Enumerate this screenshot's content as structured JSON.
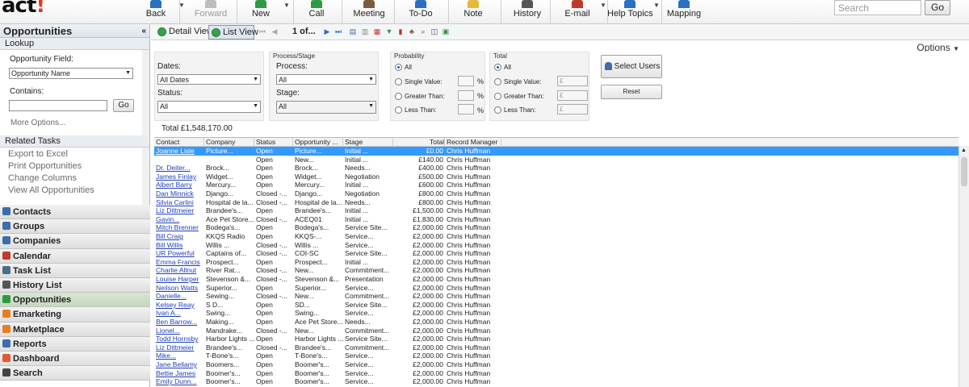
{
  "app": {
    "logo_text": "act",
    "logo_bang": "!"
  },
  "toolbar": [
    {
      "label": "Back",
      "icon": "back-arrow-icon",
      "color": "#2a6fc1",
      "x": 0
    },
    {
      "label": "Forward",
      "icon": "forward-arrow-icon",
      "color": "#bdbdbd",
      "x": 0
    },
    {
      "label": "New",
      "icon": "new-record-icon",
      "color": "#2f9a43",
      "x": 0
    },
    {
      "label": "Call",
      "icon": "phone-icon",
      "color": "#2f9a43",
      "x": 0
    },
    {
      "label": "Meeting",
      "icon": "meeting-icon",
      "color": "#7a5c3c",
      "x": 0
    },
    {
      "label": "To-Do",
      "icon": "todo-icon",
      "color": "#2a6fc1",
      "x": 0
    },
    {
      "label": "Note",
      "icon": "note-icon",
      "color": "#e7b93a",
      "x": 0
    },
    {
      "label": "History",
      "icon": "history-icon",
      "color": "#555555",
      "x": 0
    },
    {
      "label": "E-mail",
      "icon": "email-icon",
      "color": "#c0392b",
      "x": 0
    },
    {
      "label": "Help Topics",
      "icon": "help-icon",
      "color": "#2a6fc1",
      "x": 0
    },
    {
      "label": "Mapping",
      "icon": "globe-icon",
      "color": "#2a6fc1",
      "x": 0
    }
  ],
  "search": {
    "placeholder": "Search",
    "go_label": "Go"
  },
  "left_panel": {
    "title": "Opportunities",
    "collapse_glyph": "«",
    "lookup": {
      "header": "Lookup",
      "field_label": "Opportunity Field:",
      "field_value": "Opportunity Name",
      "contains_label": "Contains:",
      "go_label": "Go",
      "more_options": "More Options..."
    },
    "related_tasks": {
      "header": "Related Tasks",
      "items": [
        "Export to Excel",
        "Print Opportunities",
        "Change Columns",
        "View All Opportunities"
      ]
    },
    "nav": [
      {
        "label": "Contacts",
        "color": "#3d6ea8"
      },
      {
        "label": "Groups",
        "color": "#3d6ea8"
      },
      {
        "label": "Companies",
        "color": "#3d6ea8"
      },
      {
        "label": "Calendar",
        "color": "#c0392b"
      },
      {
        "label": "Task List",
        "color": "#4a6b8a"
      },
      {
        "label": "History List",
        "color": "#555555"
      },
      {
        "label": "Opportunities",
        "color": "#2f9a43",
        "active": true
      },
      {
        "label": "Emarketing",
        "color": "#e67e22"
      },
      {
        "label": "Marketplace",
        "color": "#e67e22"
      },
      {
        "label": "Reports",
        "color": "#3d6ea8"
      },
      {
        "label": "Dashboard",
        "color": "#e05a2b"
      },
      {
        "label": "Search",
        "color": "#444444"
      }
    ]
  },
  "viewbar": {
    "detail_view": "Detail View",
    "list_view": "List View",
    "pager": "1 of..."
  },
  "options_label": "Options",
  "filters": {
    "dates_label": "Dates:",
    "dates_value": "All Dates",
    "status_label": "Status:",
    "status_value": "All",
    "process_stage_title": "Process/Stage",
    "process_label": "Process:",
    "process_value": "All",
    "stage_label": "Stage:",
    "stage_value": "All",
    "probability_title": "Probability",
    "total_title": "Total",
    "radio_all": "All",
    "radio_single": "Single Value:",
    "radio_greater": "Greater Than:",
    "radio_less": "Less Than:",
    "pct": "%",
    "currency": "£",
    "select_users": "Select Users",
    "reset": "Reset",
    "total_text": "Total £1,548,170.00"
  },
  "grid": {
    "columns": [
      "Contact",
      "Company",
      "Status",
      "Opportunity ...",
      "Stage",
      "Total",
      "Record Manager"
    ],
    "rows": [
      [
        "Joanne Lisle",
        "Picture...",
        "Open",
        "Picture...",
        "Initial ...",
        "£0.00",
        "Chris Huffman"
      ],
      [
        "",
        "",
        "Open",
        "New...",
        "Initial ...",
        "£140.00",
        "Chris Huffman"
      ],
      [
        "Dr. Deiter...",
        "Brock...",
        "Open",
        "Brock...",
        "Needs...",
        "£400.00",
        "Chris Huffman"
      ],
      [
        "James Finlay",
        "Widget...",
        "Open",
        "Widget...",
        "Negotiation",
        "£500.00",
        "Chris Huffman"
      ],
      [
        "Albert Barry",
        "Mercury...",
        "Open",
        "Mercury...",
        "Initial ...",
        "£600.00",
        "Chris Huffman"
      ],
      [
        "Dan Minnick",
        "Django...",
        "Closed -...",
        "Django...",
        "Negotiation",
        "£800.00",
        "Chris Huffman"
      ],
      [
        "Silvia Carlini",
        "Hospital de la...",
        "Closed -...",
        "Hospital de la...",
        "Needs...",
        "£800.00",
        "Chris Huffman"
      ],
      [
        "Liz Dittmeier",
        "Brandee's...",
        "Open",
        "Brandee's...",
        "Initial ...",
        "£1,500.00",
        "Chris Huffman"
      ],
      [
        "Gavin...",
        "Ace Pet Store...",
        "Closed -...",
        "ACEQ01",
        "Initial ...",
        "£1,830.00",
        "Chris Huffman"
      ],
      [
        "Mitch Brenner",
        "Bodega's...",
        "Open",
        "Bodega's...",
        "Service Site...",
        "£2,000.00",
        "Chris Huffman"
      ],
      [
        "Bill Craig",
        "KKQS Radio",
        "Open",
        "KKQS-...",
        "Service...",
        "£2,000.00",
        "Chris Huffman"
      ],
      [
        "Bill Willis",
        "Willis ...",
        "Closed -...",
        "Willis ...",
        "Service...",
        "£2,000.00",
        "Chris Huffman"
      ],
      [
        "UR Powerful",
        "Captains of...",
        "Closed -...",
        "COI-SC",
        "Service Site...",
        "£2,000.00",
        "Chris Huffman"
      ],
      [
        "Emma Francis",
        "Prospect...",
        "Open",
        "Prospect...",
        "Initial ...",
        "£2,000.00",
        "Chris Huffman"
      ],
      [
        "Charlie Allnut",
        "River Rat...",
        "Closed -...",
        "New...",
        "Commitment...",
        "£2,000.00",
        "Chris Huffman"
      ],
      [
        "Louise Harper",
        "Stevenson &...",
        "Closed -...",
        "Stevenson &...",
        "Presentation",
        "£2,000.00",
        "Chris Huffman"
      ],
      [
        "Neilson Watts",
        "Superior...",
        "Open",
        "Superior...",
        "Service...",
        "£2,000.00",
        "Chris Huffman"
      ],
      [
        "Danielle...",
        "Sewing...",
        "Closed -...",
        "New...",
        "Commitment...",
        "£2,000.00",
        "Chris Huffman"
      ],
      [
        "Kelsey Reay",
        "S D...",
        "Open",
        "SD...",
        "Service Site...",
        "£2,000.00",
        "Chris Huffman"
      ],
      [
        "Ivan A...",
        "Swing...",
        "Open",
        "Swing...",
        "Service...",
        "£2,000.00",
        "Chris Huffman"
      ],
      [
        "Ben Barrow...",
        "Making...",
        "Open",
        "Ace Pet Store...",
        "Needs...",
        "£2,000.00",
        "Chris Huffman"
      ],
      [
        "Lionel...",
        "Mandrake...",
        "Closed -...",
        "New...",
        "Commitment...",
        "£2,000.00",
        "Chris Huffman"
      ],
      [
        "Todd Hornsby",
        "Harbor Lights ...",
        "Open",
        "Harbor Lights ...",
        "Service Site...",
        "£2,000.00",
        "Chris Huffman"
      ],
      [
        "Liz Dittmeier",
        "Brandee's...",
        "Closed -...",
        "Brandee's...",
        "Commitment...",
        "£2,000.00",
        "Chris Huffman"
      ],
      [
        "Mike...",
        "T-Bone's...",
        "Open",
        "T-Bone's...",
        "Service...",
        "£2,000.00",
        "Chris Huffman"
      ],
      [
        "Jane Bellamy",
        "Boomers...",
        "Open",
        "Boomer's...",
        "Service...",
        "£2,000.00",
        "Chris Huffman"
      ],
      [
        "Bettie James",
        "Boomer's...",
        "Open",
        "Boomer's...",
        "Service...",
        "£2,000.00",
        "Chris Huffman"
      ],
      [
        "Emily Dunn...",
        "Boomer's...",
        "Open",
        "Boomer's...",
        "Service...",
        "£2,000.00",
        "Chris Huffman"
      ]
    ]
  }
}
